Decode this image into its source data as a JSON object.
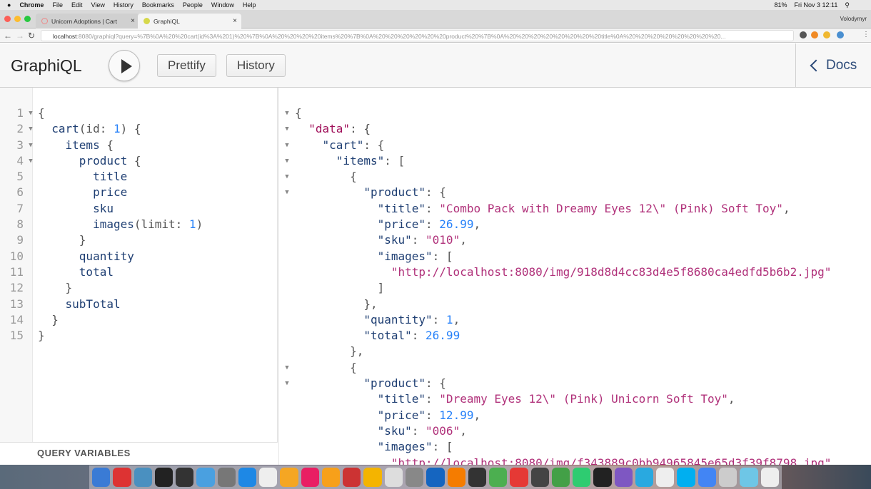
{
  "menubar": {
    "app": "Chrome",
    "items": [
      "File",
      "Edit",
      "View",
      "History",
      "Bookmarks",
      "People",
      "Window",
      "Help"
    ],
    "battery": "81%",
    "clock": "Fri Nov 3  12:11"
  },
  "tabs": [
    {
      "title": "Unicorn Adoptions | Cart",
      "active": false
    },
    {
      "title": "GraphiQL",
      "active": true
    }
  ],
  "profile": "Volodymyr",
  "address": {
    "host": "localhost",
    "rest": ":8080/graphiql?query=%7B%0A%20%20cart(id%3A%201)%20%7B%0A%20%20%20%20items%20%7B%0A%20%20%20%20%20%20product%20%7B%0A%20%20%20%20%20%20%20%20title%0A%20%20%20%20%20%20%20%20..."
  },
  "toolbar": {
    "logo": "GraphiQL",
    "prettify": "Prettify",
    "history": "History",
    "docs": "Docs"
  },
  "query_lines": [
    [
      [
        "p",
        "{"
      ]
    ],
    [
      [
        "f",
        "  cart"
      ],
      [
        "p",
        "(id: "
      ],
      [
        "n",
        "1"
      ],
      [
        "p",
        ") {"
      ]
    ],
    [
      [
        "f",
        "    items"
      ],
      [
        "p",
        " {"
      ]
    ],
    [
      [
        "f",
        "      product"
      ],
      [
        "p",
        " {"
      ]
    ],
    [
      [
        "f",
        "        title"
      ]
    ],
    [
      [
        "f",
        "        price"
      ]
    ],
    [
      [
        "f",
        "        sku"
      ]
    ],
    [
      [
        "f",
        "        images"
      ],
      [
        "p",
        "(limit: "
      ],
      [
        "n",
        "1"
      ],
      [
        "p",
        ")"
      ]
    ],
    [
      [
        "p",
        "      }"
      ]
    ],
    [
      [
        "f",
        "      quantity"
      ]
    ],
    [
      [
        "f",
        "      total"
      ]
    ],
    [
      [
        "p",
        "    }"
      ]
    ],
    [
      [
        "f",
        "    subTotal"
      ]
    ],
    [
      [
        "p",
        "  }"
      ]
    ],
    [
      [
        "p",
        "}"
      ]
    ]
  ],
  "query_folds": [
    1,
    2,
    3,
    4
  ],
  "query_variables_label": "QUERY VARIABLES",
  "result_lines": [
    [
      [
        "p",
        "{"
      ]
    ],
    [
      [
        "dk",
        "  \"data\""
      ],
      [
        "p",
        ": {"
      ]
    ],
    [
      [
        "k",
        "    \"cart\""
      ],
      [
        "p",
        ": {"
      ]
    ],
    [
      [
        "k",
        "      \"items\""
      ],
      [
        "p",
        ": ["
      ]
    ],
    [
      [
        "p",
        "        {"
      ]
    ],
    [
      [
        "k",
        "          \"product\""
      ],
      [
        "p",
        ": {"
      ]
    ],
    [
      [
        "k",
        "            \"title\""
      ],
      [
        "p",
        ": "
      ],
      [
        "s",
        "\"Combo Pack with Dreamy Eyes 12\\\" (Pink) Soft Toy\""
      ],
      [
        "p",
        ","
      ]
    ],
    [
      [
        "k",
        "            \"price\""
      ],
      [
        "p",
        ": "
      ],
      [
        "n",
        "26.99"
      ],
      [
        "p",
        ","
      ]
    ],
    [
      [
        "k",
        "            \"sku\""
      ],
      [
        "p",
        ": "
      ],
      [
        "s",
        "\"010\""
      ],
      [
        "p",
        ","
      ]
    ],
    [
      [
        "k",
        "            \"images\""
      ],
      [
        "p",
        ": ["
      ]
    ],
    [
      [
        "s",
        "              \"http://localhost:8080/img/918d8d4cc83d4e5f8680ca4edfd5b6b2.jpg\""
      ]
    ],
    [
      [
        "p",
        "            ]"
      ]
    ],
    [
      [
        "p",
        "          },"
      ]
    ],
    [
      [
        "k",
        "          \"quantity\""
      ],
      [
        "p",
        ": "
      ],
      [
        "n",
        "1"
      ],
      [
        "p",
        ","
      ]
    ],
    [
      [
        "k",
        "          \"total\""
      ],
      [
        "p",
        ": "
      ],
      [
        "n",
        "26.99"
      ]
    ],
    [
      [
        "p",
        "        },"
      ]
    ],
    [
      [
        "p",
        "        {"
      ]
    ],
    [
      [
        "k",
        "          \"product\""
      ],
      [
        "p",
        ": {"
      ]
    ],
    [
      [
        "k",
        "            \"title\""
      ],
      [
        "p",
        ": "
      ],
      [
        "s",
        "\"Dreamy Eyes 12\\\" (Pink) Unicorn Soft Toy\""
      ],
      [
        "p",
        ","
      ]
    ],
    [
      [
        "k",
        "            \"price\""
      ],
      [
        "p",
        ": "
      ],
      [
        "n",
        "12.99"
      ],
      [
        "p",
        ","
      ]
    ],
    [
      [
        "k",
        "            \"sku\""
      ],
      [
        "p",
        ": "
      ],
      [
        "s",
        "\"006\""
      ],
      [
        "p",
        ","
      ]
    ],
    [
      [
        "k",
        "            \"images\""
      ],
      [
        "p",
        ": ["
      ]
    ],
    [
      [
        "s",
        "              \"http://localhost:8080/img/f343889c0bb94965845e65d3f39f8798.jpg\""
      ]
    ]
  ],
  "result_folds": [
    1,
    2,
    3,
    4,
    5,
    6,
    17,
    18
  ],
  "dock_colors": [
    "#3a7bd5",
    "#d33",
    "#4a90c0",
    "#222",
    "#333",
    "#4aa0e0",
    "#777",
    "#1e88e5",
    "#eee",
    "#f5a623",
    "#e91e63",
    "#f7a01a",
    "#c33",
    "#f4b400",
    "#ddd",
    "#888",
    "#1565c0",
    "#f57c00",
    "#333",
    "#4caf50",
    "#e53935",
    "#444",
    "#43a047",
    "#2ecc71",
    "#222",
    "#7e57c2",
    "#29a9e0",
    "#eee",
    "#00aff0",
    "#4285f4",
    "#ccc",
    "#6ec6e6",
    "#eee"
  ]
}
